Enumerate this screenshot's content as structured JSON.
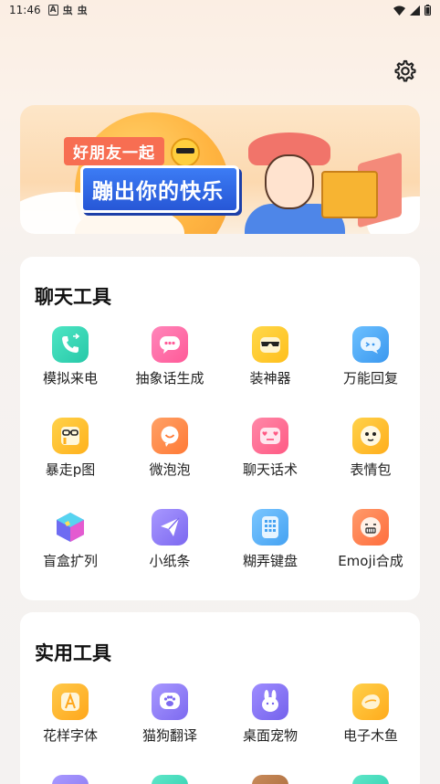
{
  "status_bar": {
    "time": "11:46",
    "left_icons": [
      "A",
      "虫",
      "虫"
    ],
    "right_icons": [
      "wifi-icon",
      "signal-icon",
      "battery-icon"
    ]
  },
  "settings": {
    "icon": "gear-icon"
  },
  "banner": {
    "pill_text": "好朋友一起",
    "main_text": "蹦出你的快乐"
  },
  "sections": [
    {
      "title": "聊天工具",
      "items": [
        {
          "label": "模拟来电",
          "icon": "phone-icon",
          "color": "#3ad6b6"
        },
        {
          "label": "抽象话生成",
          "icon": "chat-bubble-icon",
          "color": "#ff6aa6"
        },
        {
          "label": "装神器",
          "icon": "sunglasses-icon",
          "color": "#ffc928"
        },
        {
          "label": "万能回复",
          "icon": "reply-bubble-icon",
          "color": "#4aa8f5"
        },
        {
          "label": "暴走p图",
          "icon": "glasses-p-icon",
          "color": "#ffc23a"
        },
        {
          "label": "微泡泡",
          "icon": "smile-bubble-icon",
          "color": "#ff8b4a"
        },
        {
          "label": "聊天话术",
          "icon": "heart-eyes-icon",
          "color": "#ff6a8d"
        },
        {
          "label": "表情包",
          "icon": "face-icon",
          "color": "#ffbe2e"
        },
        {
          "label": "盲盒扩列",
          "icon": "cube-icon",
          "color": "#6b7cf0"
        },
        {
          "label": "小纸条",
          "icon": "paper-plane-icon",
          "color": "#8c7cf6"
        },
        {
          "label": "糊弄键盘",
          "icon": "keyboard-icon",
          "color": "#58b4f6"
        },
        {
          "label": "Emoji合成",
          "icon": "emoji-face-icon",
          "color": "#ff7a50"
        }
      ]
    },
    {
      "title": "实用工具",
      "items": [
        {
          "label": "花样字体",
          "icon": "font-a-icon",
          "color": "#ffb32a"
        },
        {
          "label": "猫狗翻译",
          "icon": "paw-icon",
          "color": "#8f7cf4"
        },
        {
          "label": "桌面宠物",
          "icon": "bunny-icon",
          "color": "#8a78f0"
        },
        {
          "label": "电子木鱼",
          "icon": "wooden-fish-icon",
          "color": "#ffbd2b"
        }
      ]
    }
  ]
}
